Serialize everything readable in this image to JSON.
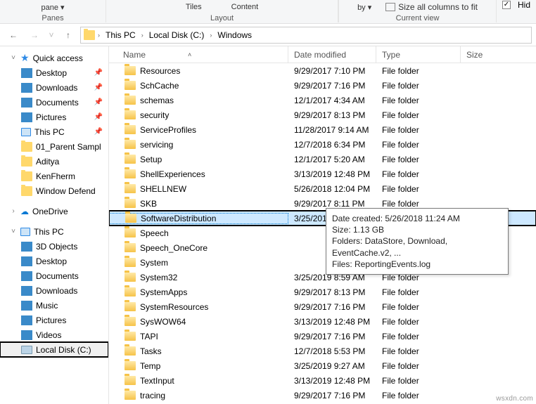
{
  "ribbon": {
    "pane_label": "pane ▾",
    "panes_group": "Panes",
    "layout_group": "Layout",
    "tiles": "Tiles",
    "content": "Content",
    "sort_by": "by ▾",
    "size_all": "Size all columns to fit",
    "hid": "Hid",
    "view_group": "Current view"
  },
  "breadcrumb": {
    "pc": "This PC",
    "disk": "Local Disk (C:)",
    "windows": "Windows"
  },
  "columns": {
    "name": "Name",
    "date": "Date modified",
    "type": "Type",
    "size": "Size"
  },
  "sidebar": {
    "quick": "Quick access",
    "desktop": "Desktop",
    "downloads": "Downloads",
    "documents": "Documents",
    "pictures": "Pictures",
    "thispc": "This PC",
    "parent": "01_Parent Sampl",
    "aditya": "Aditya",
    "kenfherm": "KenFherm",
    "windef": "Window Defend",
    "onedrive": "OneDrive",
    "thispc2": "This PC",
    "obj3d": "3D Objects",
    "desktop2": "Desktop",
    "documents2": "Documents",
    "downloads2": "Downloads",
    "music": "Music",
    "pictures2": "Pictures",
    "videos": "Videos",
    "localdisk": "Local Disk (C:)"
  },
  "rows": [
    {
      "name": "Resources",
      "date": "9/29/2017 7:10 PM",
      "type": "File folder"
    },
    {
      "name": "SchCache",
      "date": "9/29/2017 7:16 PM",
      "type": "File folder"
    },
    {
      "name": "schemas",
      "date": "12/1/2017 4:34 AM",
      "type": "File folder"
    },
    {
      "name": "security",
      "date": "9/29/2017 8:13 PM",
      "type": "File folder"
    },
    {
      "name": "ServiceProfiles",
      "date": "11/28/2017 9:14 AM",
      "type": "File folder"
    },
    {
      "name": "servicing",
      "date": "12/7/2018 6:34 PM",
      "type": "File folder"
    },
    {
      "name": "Setup",
      "date": "12/1/2017 5:20 AM",
      "type": "File folder"
    },
    {
      "name": "ShellExperiences",
      "date": "3/13/2019 12:48 PM",
      "type": "File folder"
    },
    {
      "name": "SHELLNEW",
      "date": "5/26/2018 12:04 PM",
      "type": "File folder"
    },
    {
      "name": "SKB",
      "date": "9/29/2017 8:11 PM",
      "type": "File folder"
    },
    {
      "name": "SoftwareDistribution",
      "date": "3/25/2019 9:02 AM",
      "type": "File folder",
      "selected": true
    },
    {
      "name": "Speech",
      "date": "",
      "type": "folder"
    },
    {
      "name": "Speech_OneCore",
      "date": "",
      "type": "folder"
    },
    {
      "name": "System",
      "date": "",
      "type": "folder"
    },
    {
      "name": "System32",
      "date": "3/25/2019 8:59 AM",
      "type": "File folder"
    },
    {
      "name": "SystemApps",
      "date": "9/29/2017 8:13 PM",
      "type": "File folder"
    },
    {
      "name": "SystemResources",
      "date": "9/29/2017 7:16 PM",
      "type": "File folder"
    },
    {
      "name": "SysWOW64",
      "date": "3/13/2019 12:48 PM",
      "type": "File folder"
    },
    {
      "name": "TAPI",
      "date": "9/29/2017 7:16 PM",
      "type": "File folder"
    },
    {
      "name": "Tasks",
      "date": "12/7/2018 5:53 PM",
      "type": "File folder"
    },
    {
      "name": "Temp",
      "date": "3/25/2019 9:27 AM",
      "type": "File folder"
    },
    {
      "name": "TextInput",
      "date": "3/13/2019 12:48 PM",
      "type": "File folder"
    },
    {
      "name": "tracing",
      "date": "9/29/2017 7:16 PM",
      "type": "File folder"
    }
  ],
  "tooltip": {
    "l1": "Date created: 5/26/2018 11:24 AM",
    "l2": "Size: 1.13 GB",
    "l3": "Folders: DataStore, Download, EventCache.v2, ...",
    "l4": "Files: ReportingEvents.log"
  },
  "watermark": "wsxdn.com"
}
